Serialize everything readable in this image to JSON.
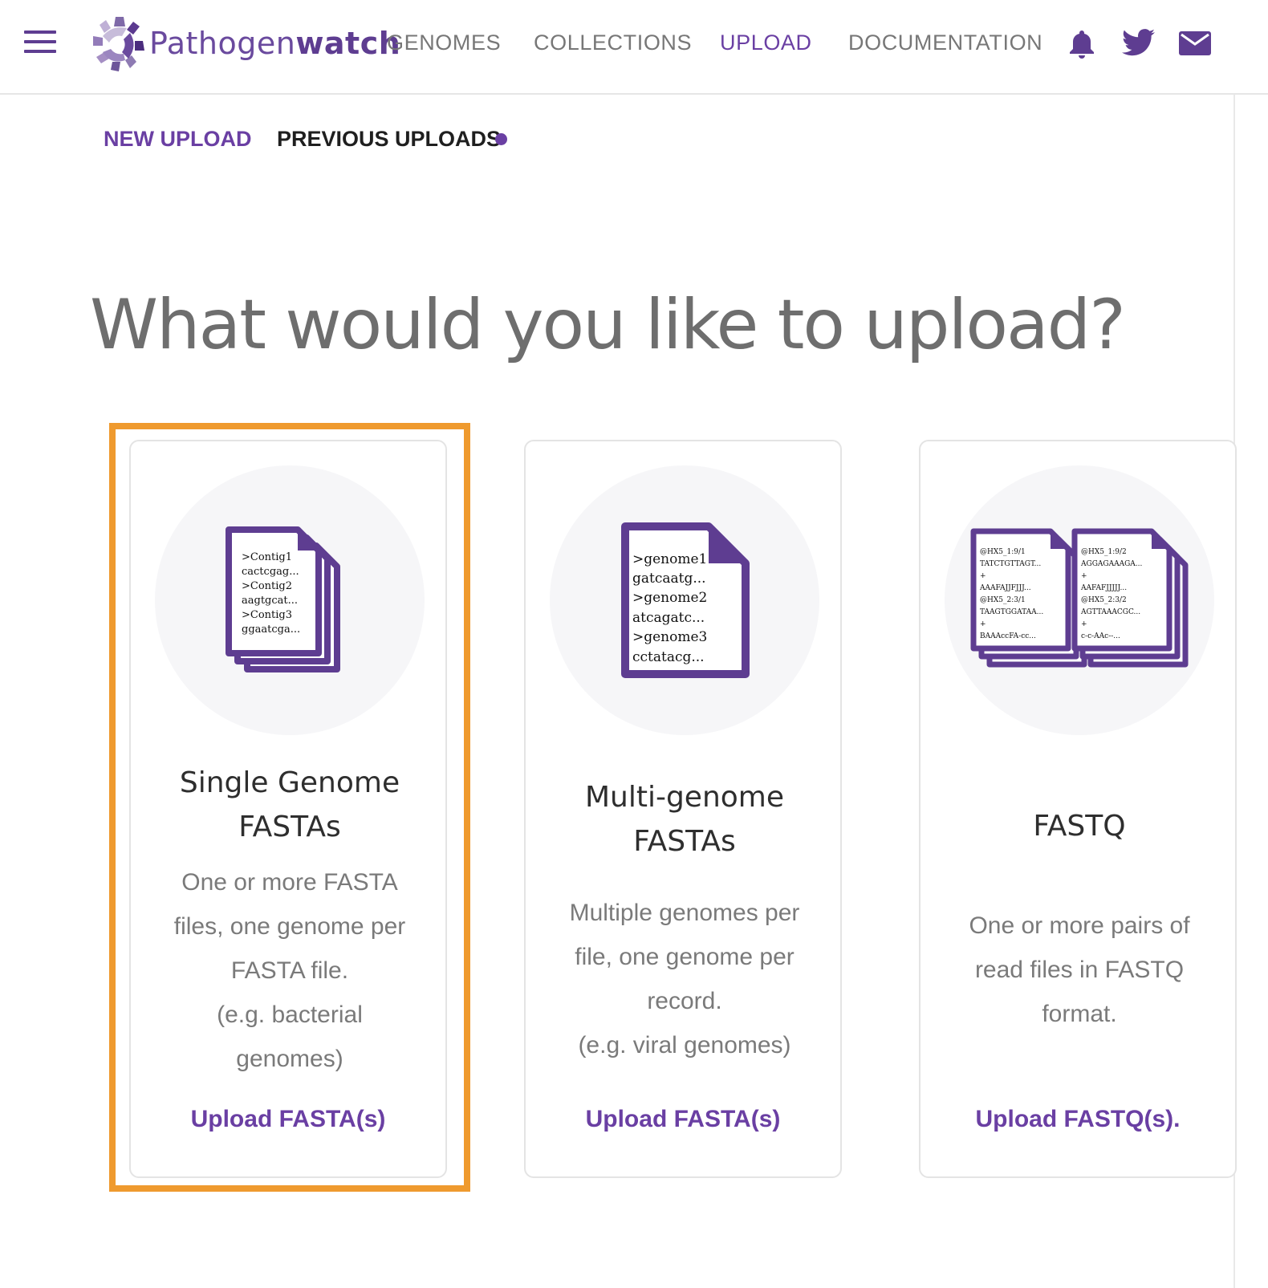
{
  "header": {
    "logo_text_light": "Pathogen",
    "logo_text_bold": "watch",
    "nav": [
      "GENOMES",
      "COLLECTIONS",
      "UPLOAD",
      "DOCUMENTATION"
    ],
    "active_nav": "UPLOAD",
    "icons": [
      "menu-icon",
      "bell-icon",
      "twitter-icon",
      "mail-icon"
    ]
  },
  "subnav": {
    "new_upload": "NEW UPLOAD",
    "previous_uploads": "PREVIOUS UPLOADS"
  },
  "main": {
    "title": "What would you like to upload?"
  },
  "cards": [
    {
      "title_line1": "Single Genome",
      "title_line2": "FASTAs",
      "desc": [
        "One or more FASTA",
        "files, one genome per",
        "FASTA file.",
        "(e.g. bacterial",
        "genomes)"
      ],
      "link": "Upload FASTA(s)",
      "doc_lines": [
        ">Contig1",
        "cactcgag...",
        ">Contig2",
        "aagtgcat...",
        ">Contig3",
        "ggaatcga..."
      ]
    },
    {
      "title_line1": "Multi-genome",
      "title_line2": "FASTAs",
      "desc": [
        "Multiple genomes per",
        "file, one genome per",
        "record.",
        "(e.g. viral genomes)"
      ],
      "link": "Upload FASTA(s)",
      "doc_lines": [
        ">genome1",
        "gatcaatg...",
        ">genome2",
        "atcagatc...",
        ">genome3",
        "cctatacg..."
      ]
    },
    {
      "title_line1": "FASTQ",
      "desc": [
        "One or more pairs of",
        "read files in FASTQ",
        "format."
      ],
      "link": "Upload FASTQ(s).",
      "doc_left_lines": [
        "@HX5_1:9/1",
        "TATCTGTTAGT...",
        "+",
        "AAAFAJJFJJJ...",
        "@HX5_2:3/1",
        "TAAGTGGATAA...",
        "+",
        "BAAAccFA-cc..."
      ],
      "doc_right_lines": [
        "@HX5_1:9/2",
        "AGGAGAAAGA...",
        "+",
        "AAFAFJJJJJ...",
        "@HX5_2:3/2",
        "AGTTAAACGC...",
        "+",
        "c-c-AAc--..."
      ]
    }
  ],
  "colors": {
    "brand": "#6a3fa3",
    "highlight": "#ef9a2e",
    "title_gray": "#6e6e6e"
  }
}
